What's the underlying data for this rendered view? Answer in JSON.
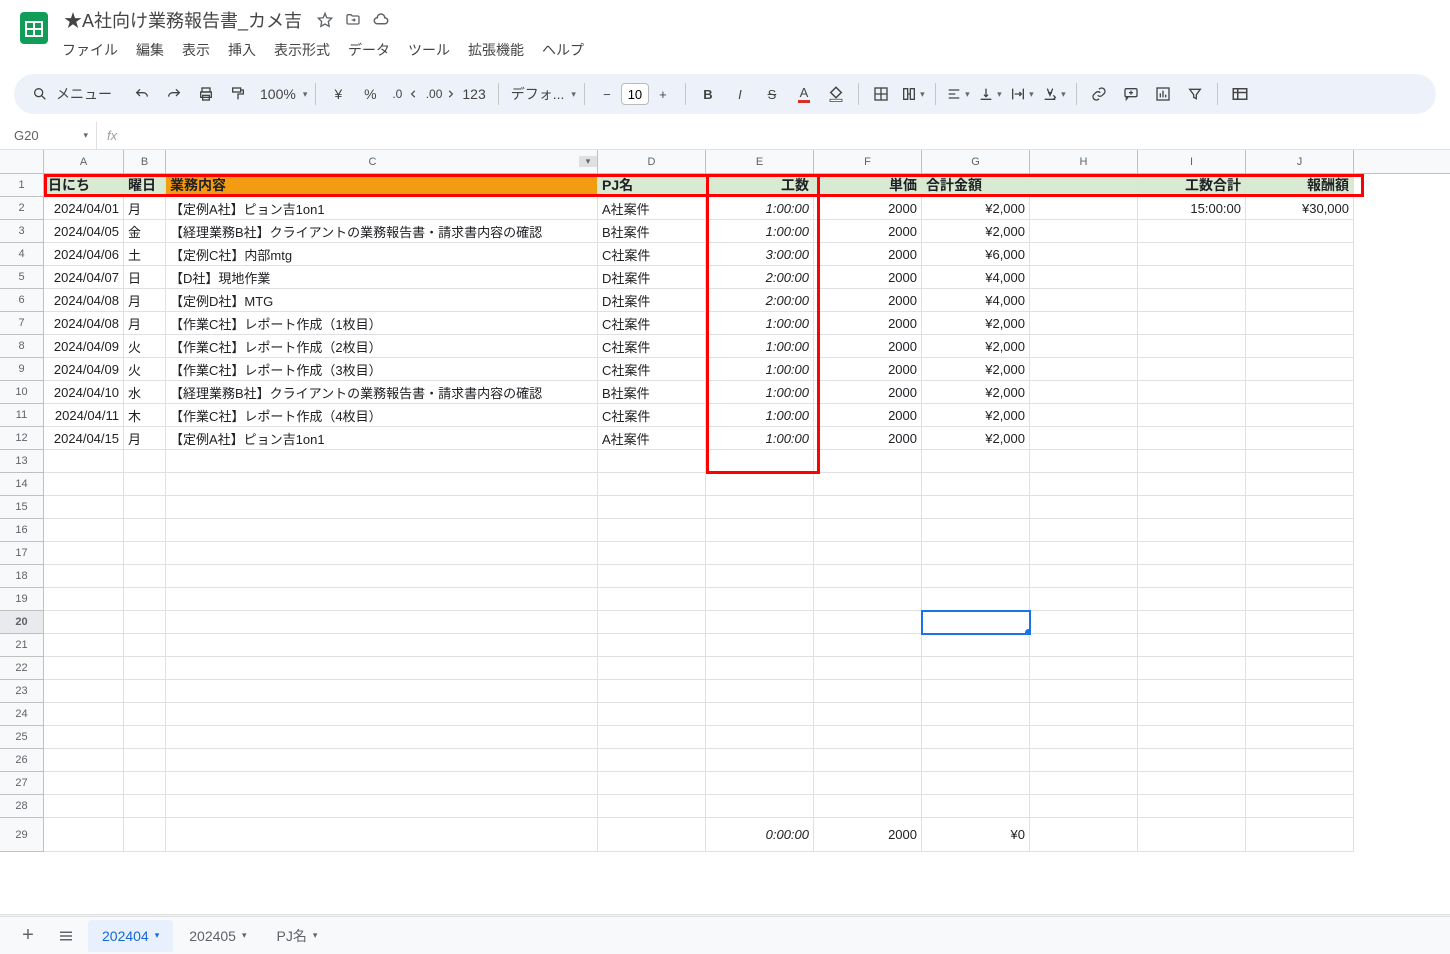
{
  "doc": {
    "title": "★A社向け業務報告書_カメ吉"
  },
  "menu": [
    "ファイル",
    "編集",
    "表示",
    "挿入",
    "表示形式",
    "データ",
    "ツール",
    "拡張機能",
    "ヘルプ"
  ],
  "toolbar": {
    "search": "メニュー",
    "zoom": "100%",
    "currency": "¥",
    "percent": "%",
    "fmt123": "123",
    "font": "デフォ...",
    "font_size": "10"
  },
  "name_box": "G20",
  "columns": [
    "A",
    "B",
    "C",
    "D",
    "E",
    "F",
    "G",
    "H",
    "I",
    "J"
  ],
  "headers": {
    "A": "日にち",
    "B": "曜日",
    "C": "業務内容",
    "D": "PJ名",
    "E": "工数",
    "F": "単価",
    "G": "合計金額",
    "H": "",
    "I": "工数合計",
    "J": "報酬額"
  },
  "rows": [
    {
      "n": 2,
      "A": "2024/04/01",
      "B": "月",
      "C": "【定例A社】ピョン吉1on1",
      "D": "A社案件",
      "E": "1:00:00",
      "F": "2000",
      "G": "¥2,000",
      "I": "15:00:00",
      "J": "¥30,000"
    },
    {
      "n": 3,
      "A": "2024/04/05",
      "B": "金",
      "C": "【経理業務B社】クライアントの業務報告書・請求書内容の確認",
      "D": "B社案件",
      "E": "1:00:00",
      "F": "2000",
      "G": "¥2,000"
    },
    {
      "n": 4,
      "A": "2024/04/06",
      "B": "土",
      "C": "【定例C社】内部mtg",
      "D": "C社案件",
      "E": "3:00:00",
      "F": "2000",
      "G": "¥6,000"
    },
    {
      "n": 5,
      "A": "2024/04/07",
      "B": "日",
      "C": "【D社】現地作業",
      "D": "D社案件",
      "E": "2:00:00",
      "F": "2000",
      "G": "¥4,000"
    },
    {
      "n": 6,
      "A": "2024/04/08",
      "B": "月",
      "C": "【定例D社】MTG",
      "D": "D社案件",
      "E": "2:00:00",
      "F": "2000",
      "G": "¥4,000"
    },
    {
      "n": 7,
      "A": "2024/04/08",
      "B": "月",
      "C": "【作業C社】レポート作成（1枚目）",
      "D": "C社案件",
      "E": "1:00:00",
      "F": "2000",
      "G": "¥2,000"
    },
    {
      "n": 8,
      "A": "2024/04/09",
      "B": "火",
      "C": "【作業C社】レポート作成（2枚目）",
      "D": "C社案件",
      "E": "1:00:00",
      "F": "2000",
      "G": "¥2,000"
    },
    {
      "n": 9,
      "A": "2024/04/09",
      "B": "火",
      "C": "【作業C社】レポート作成（3枚目）",
      "D": "C社案件",
      "E": "1:00:00",
      "F": "2000",
      "G": "¥2,000"
    },
    {
      "n": 10,
      "A": "2024/04/10",
      "B": "水",
      "C": "【経理業務B社】クライアントの業務報告書・請求書内容の確認",
      "D": "B社案件",
      "E": "1:00:00",
      "F": "2000",
      "G": "¥2,000"
    },
    {
      "n": 11,
      "A": "2024/04/11",
      "B": "木",
      "C": "【作業C社】レポート作成（4枚目）",
      "D": "C社案件",
      "E": "1:00:00",
      "F": "2000",
      "G": "¥2,000"
    },
    {
      "n": 12,
      "A": "2024/04/15",
      "B": "月",
      "C": "【定例A社】ピョン吉1on1",
      "D": "A社案件",
      "E": "1:00:00",
      "F": "2000",
      "G": "¥2,000"
    }
  ],
  "empty_rows": [
    13,
    14,
    15,
    16,
    17,
    18,
    19,
    20,
    21,
    22,
    23,
    24,
    25,
    26,
    27,
    28
  ],
  "row29": {
    "E": "0:00:00",
    "F": "2000",
    "G": "¥0"
  },
  "sheets": [
    {
      "label": "202404",
      "active": true
    },
    {
      "label": "202405",
      "active": false
    },
    {
      "label": "PJ名",
      "active": false
    }
  ]
}
